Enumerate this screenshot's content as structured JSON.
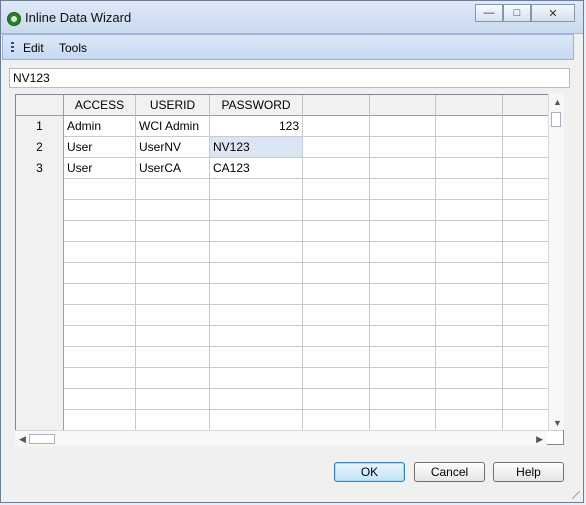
{
  "window": {
    "title": "Inline Data Wizard"
  },
  "menu": {
    "items": [
      "Edit",
      "Tools"
    ]
  },
  "current_cell_value": "NV123",
  "table": {
    "columns": [
      "ACCESS",
      "USERID",
      "PASSWORD"
    ],
    "row_numbers": [
      "1",
      "2",
      "3"
    ],
    "rows": [
      [
        "Admin",
        "WCI Admin",
        "123"
      ],
      [
        "User",
        "UserNV",
        "NV123"
      ],
      [
        "User",
        "UserCA",
        "CA123"
      ]
    ],
    "selected_cell": {
      "row": 2,
      "column": "PASSWORD"
    }
  },
  "buttons": {
    "ok": "OK",
    "cancel": "Cancel",
    "help": "Help"
  },
  "colors": {
    "selected_cell_bg": "#dbe6f5",
    "window_border": "#6d7d96",
    "ok_border": "#3c7fb1"
  },
  "icons": {
    "app_icon": "qlikview-icon",
    "minimize": "minimize-icon",
    "maximize": "maximize-icon",
    "close": "close-icon",
    "scroll_up": "arrow-up-icon",
    "scroll_down": "arrow-down-icon",
    "scroll_left": "arrow-left-icon",
    "scroll_right": "arrow-right-icon"
  }
}
